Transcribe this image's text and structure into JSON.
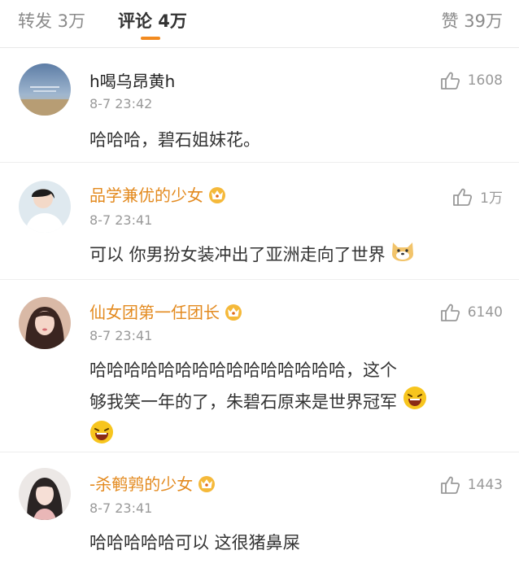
{
  "tabs": {
    "repost": "转发 3万",
    "comment": "评论 4万",
    "like": "赞 39万"
  },
  "comments": [
    {
      "username": "h喝乌昂黄h",
      "time": "8-7 23:42",
      "likes": "1608",
      "text": "哈哈哈，碧石姐妹花。"
    },
    {
      "username": "品学兼优的少女",
      "time": "8-7 23:41",
      "likes": "1万",
      "text": "可以 你男扮女装冲出了亚洲走向了世界"
    },
    {
      "username": "仙女团第一任团长",
      "time": "8-7 23:41",
      "likes": "6140",
      "text_line1": "哈哈哈哈哈哈哈哈哈哈哈哈哈哈哈，这个",
      "text_line2": "够我笑一年的了，朱碧石原来是世界冠军"
    },
    {
      "username": "-杀鹌鹑的少女",
      "time": "8-7 23:41",
      "likes": "1443",
      "text": "哈哈哈哈哈可以 这很猪鼻屎"
    }
  ],
  "colors": {
    "accent": "#f28a1f",
    "vip_name": "#e38a1f"
  }
}
